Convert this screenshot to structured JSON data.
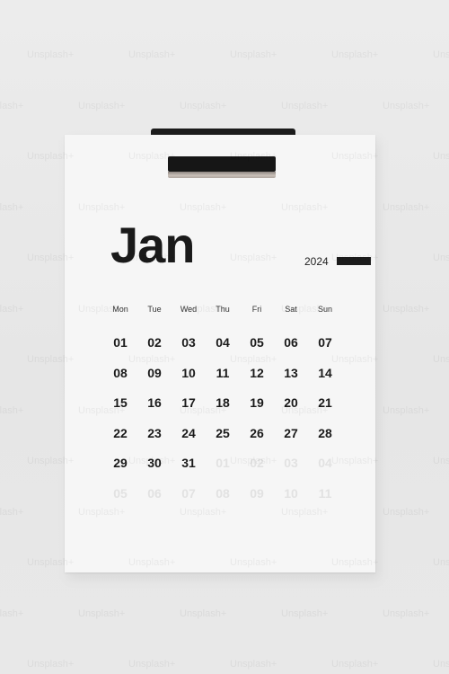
{
  "calendar": {
    "month": "Jan",
    "year": "2024",
    "weekdays": [
      "Mon",
      "Tue",
      "Wed",
      "Thu",
      "Fri",
      "Sat",
      "Sun"
    ],
    "days": [
      "01",
      "02",
      "03",
      "04",
      "05",
      "06",
      "07",
      "08",
      "09",
      "10",
      "11",
      "12",
      "13",
      "14",
      "15",
      "16",
      "17",
      "18",
      "19",
      "20",
      "21",
      "22",
      "23",
      "24",
      "25",
      "26",
      "27",
      "28",
      "29",
      "30",
      "31",
      "01",
      "02",
      "03",
      "04",
      "05",
      "06",
      "07",
      "08",
      "09",
      "10",
      "11"
    ],
    "faded_from_index": 31
  },
  "colors": {
    "ink": "#1a1a1a",
    "paper": "#f6f6f6",
    "background": "#e9e9e9",
    "clip": "#161616"
  },
  "watermark": "Unsplash+"
}
